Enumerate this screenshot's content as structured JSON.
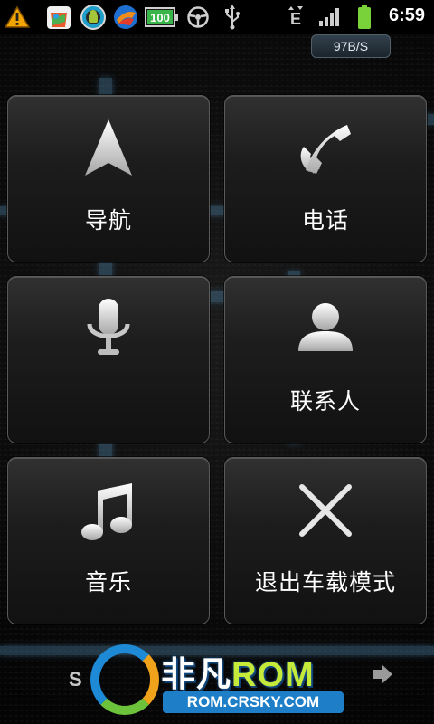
{
  "status_bar": {
    "battery_level": "100",
    "clock": "6:59",
    "net_speed": "97B/S"
  },
  "tiles": [
    {
      "label": "导航",
      "icon": "navigation-arrow-icon"
    },
    {
      "label": "电话",
      "icon": "phone-icon"
    },
    {
      "label": "",
      "icon": "microphone-icon"
    },
    {
      "label": "联系人",
      "icon": "contact-person-icon"
    },
    {
      "label": "音乐",
      "icon": "music-note-icon"
    },
    {
      "label": "退出车载模式",
      "icon": "close-x-icon"
    }
  ],
  "watermark": {
    "brand_cn": "非凡",
    "brand_rom": "ROM",
    "url": "ROM.CRSKY.COM"
  },
  "bottom_logo_text": "S"
}
